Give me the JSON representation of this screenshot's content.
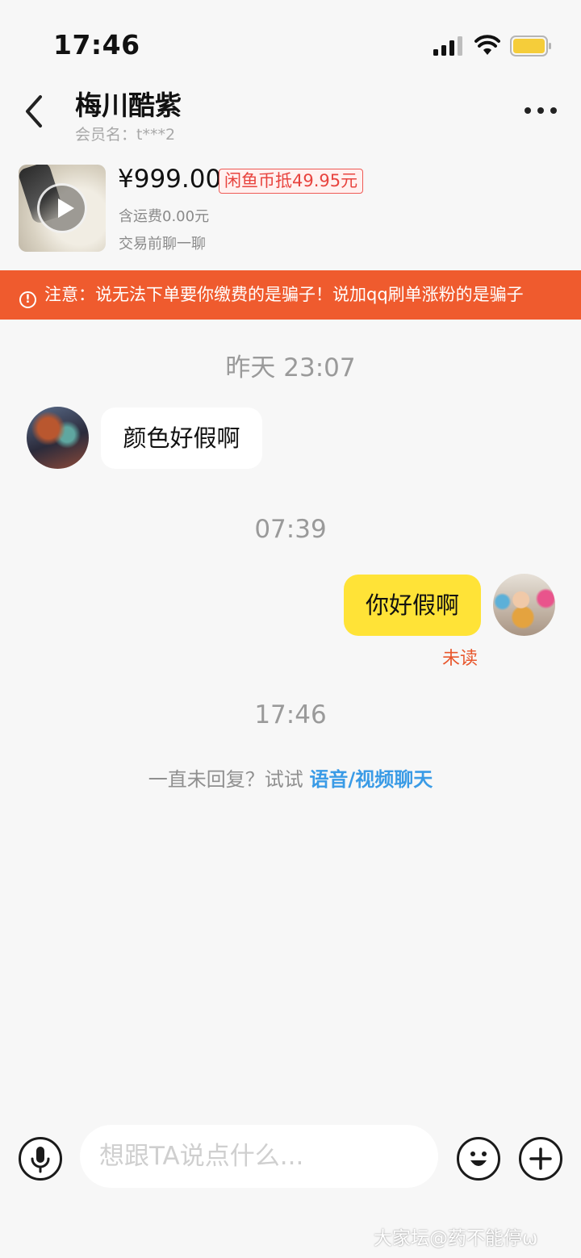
{
  "status_bar": {
    "time": "17:46"
  },
  "header": {
    "contact_name": "梅川酷紫",
    "member_id": "会员名：t***2"
  },
  "product": {
    "price": "¥999.00",
    "coin_offer": "闲鱼币抵49.95元",
    "shipping": "含运费0.00元",
    "note": "交易前聊一聊"
  },
  "warning": {
    "text": "注意：说无法下单要你缴费的是骗子！说加qq刷单涨粉的是骗子"
  },
  "chat": {
    "timestamps": [
      "昨天 23:07",
      "07:39",
      "17:46"
    ],
    "messages": [
      {
        "from": "seller",
        "text": "颜色好假啊"
      },
      {
        "from": "me",
        "text": "你好假啊",
        "status": "未读"
      }
    ],
    "hint_prefix": "一直未回复？试试 ",
    "hint_link": "语音/视频聊天"
  },
  "input": {
    "placeholder": "想跟TA说点什么..."
  },
  "watermark": "大家坛@药不能停ω",
  "colors": {
    "accent_yellow": "#ffe337",
    "warning_orange": "#ef5b2e",
    "link_blue": "#3a9be6",
    "unread_orange": "#e8572d"
  }
}
